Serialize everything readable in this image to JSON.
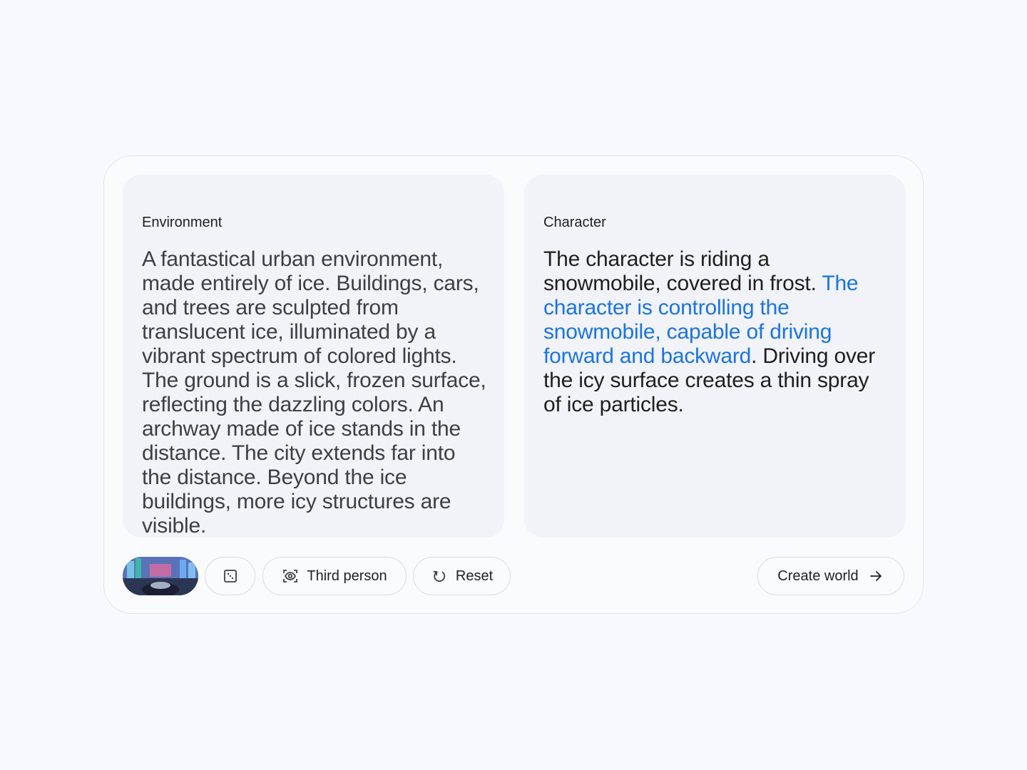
{
  "environment": {
    "label": "Environment",
    "text": "A fantastical urban environment, made entirely of ice. Buildings, cars, and trees are sculpted from translucent ice, illuminated by a vibrant spectrum of colored lights. The ground is a slick, frozen surface, reflecting the dazzling colors. An archway made of ice stands in the distance. The city extends far into the distance. Beyond the ice buildings, more icy structures are visible."
  },
  "character": {
    "label": "Character",
    "text_before": "The character is riding a snowmobile, covered in frost. ",
    "text_highlight": "The character is controlling the snowmobile, capable of driving forward and backward",
    "text_after": ". Driving over the icy surface creates a thin spray of ice particles."
  },
  "toolbar": {
    "thumbnail_icon": "preview-thumbnail",
    "random_icon": "dice-icon",
    "camera_label": "Third person",
    "camera_icon": "eye-view-icon",
    "reset_label": "Reset",
    "reset_icon": "reset-icon",
    "create_label": "Create world",
    "create_icon": "arrow-right-icon"
  },
  "colors": {
    "highlight": "#1a73e8",
    "panel_bg": "#f1f3f8",
    "page_bg": "#f8f9fc"
  }
}
